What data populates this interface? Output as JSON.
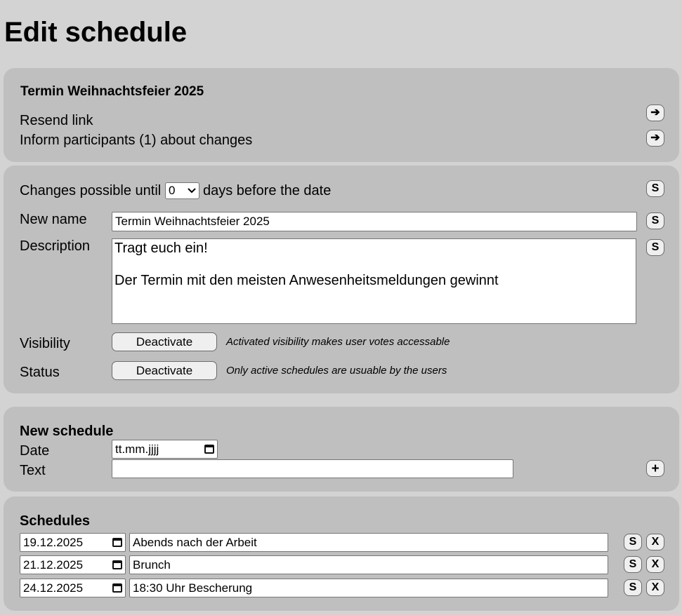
{
  "page_title": "Edit schedule",
  "header_panel": {
    "schedule_name": "Termin Weihnachtsfeier 2025",
    "resend_link_label": "Resend link",
    "inform_label": "Inform participants (1) about changes",
    "arrow_glyph": "➔"
  },
  "settings": {
    "changes_prefix": "Changes possible until",
    "changes_days_value": "0",
    "changes_suffix": "days before the date",
    "new_name_label": "New name",
    "new_name_value": "Termin Weihnachtsfeier 2025",
    "description_label": "Description",
    "description_value": "Tragt euch ein!\n\nDer Termin mit den meisten Anwesenheitsmeldungen gewinnt",
    "visibility_label": "Visibility",
    "visibility_button": "Deactivate",
    "visibility_hint": "Activated visibility makes user votes accessable",
    "status_label": "Status",
    "status_button": "Deactivate",
    "status_hint": "Only active schedules are usuable by the users",
    "save_glyph": "S"
  },
  "new_schedule": {
    "heading": "New schedule",
    "date_label": "Date",
    "date_placeholder": "tt.mm.jjjj",
    "text_label": "Text",
    "text_value": "",
    "add_glyph": "+"
  },
  "schedules": {
    "heading": "Schedules",
    "save_glyph": "S",
    "delete_glyph": "X",
    "rows": [
      {
        "date": "19.12.2025",
        "text": "Abends nach der Arbeit"
      },
      {
        "date": "21.12.2025",
        "text": "Brunch"
      },
      {
        "date": "24.12.2025",
        "text": "18:30 Uhr Bescherung"
      }
    ]
  }
}
